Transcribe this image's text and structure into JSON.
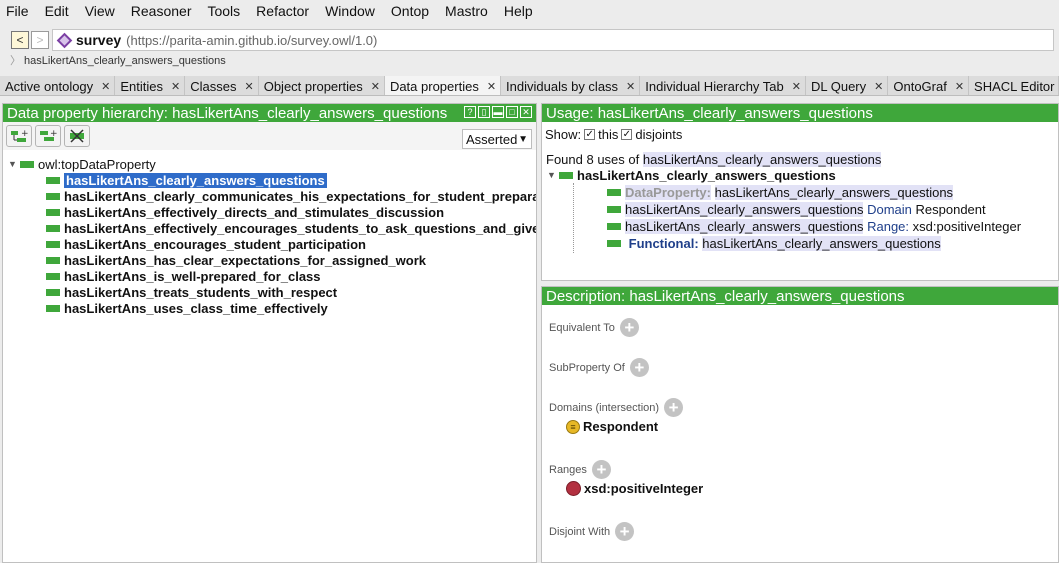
{
  "menu": [
    "File",
    "Edit",
    "View",
    "Reasoner",
    "Tools",
    "Refactor",
    "Window",
    "Ontop",
    "Mastro",
    "Help"
  ],
  "address": {
    "name": "survey",
    "iri": "(https://parita-amin.github.io/survey.owl/1.0)"
  },
  "breadcrumb": "hasLikertAns_clearly_answers_questions",
  "tabs": [
    "Active ontology",
    "Entities",
    "Classes",
    "Object properties",
    "Data properties",
    "Individuals by class",
    "Individual Hierarchy Tab",
    "DL Query",
    "OntoGraf",
    "SHACL Editor"
  ],
  "left": {
    "title": "Data property hierarchy: hasLikertAns_clearly_answers_questions",
    "asserted": "Asserted",
    "root": "owl:topDataProperty",
    "items": [
      "hasLikertAns_clearly_answers_questions",
      "hasLikertAns_clearly_communicates_his_expectations_for_student_preparation",
      "hasLikertAns_effectively_directs_and_stimulates_discussion",
      "hasLikertAns_effectively_encourages_students_to_ask_questions_and_give_answers",
      "hasLikertAns_encourages_student_participation",
      "hasLikertAns_has_clear_expectations_for_assigned_work",
      "hasLikertAns_is_well-prepared_for_class",
      "hasLikertAns_treats_students_with_respect",
      "hasLikertAns_uses_class_time_effectively"
    ]
  },
  "usage": {
    "title": "Usage: hasLikertAns_clearly_answers_questions",
    "show": "Show:",
    "this": "this",
    "disjoints": "disjoints",
    "found_prefix": "Found 8 uses of",
    "found_name": "hasLikertAns_clearly_answers_questions",
    "root": "hasLikertAns_clearly_answers_questions",
    "rows": {
      "r1_kw": "DataProperty:",
      "r1_val": "hasLikertAns_clearly_answers_questions",
      "r2_val": "hasLikertAns_clearly_answers_questions",
      "r2_kw": "Domain",
      "r2_tail": "Respondent",
      "r3_val": "hasLikertAns_clearly_answers_questions",
      "r3_kw": "Range:",
      "r3_tail": "xsd:positiveInteger",
      "r4_kw": "Functional:",
      "r4_val": "hasLikertAns_clearly_answers_questions"
    }
  },
  "description": {
    "title": "Description: hasLikertAns_clearly_answers_questions",
    "equivalent": "Equivalent To",
    "subproperty": "SubProperty Of",
    "domains": "Domains (intersection)",
    "domain_item": "Respondent",
    "ranges": "Ranges",
    "range_item": "xsd:positiveInteger",
    "disjoint": "Disjoint With"
  },
  "colors": {
    "accent": "#3fa73b",
    "selection": "#2f6cc9"
  }
}
